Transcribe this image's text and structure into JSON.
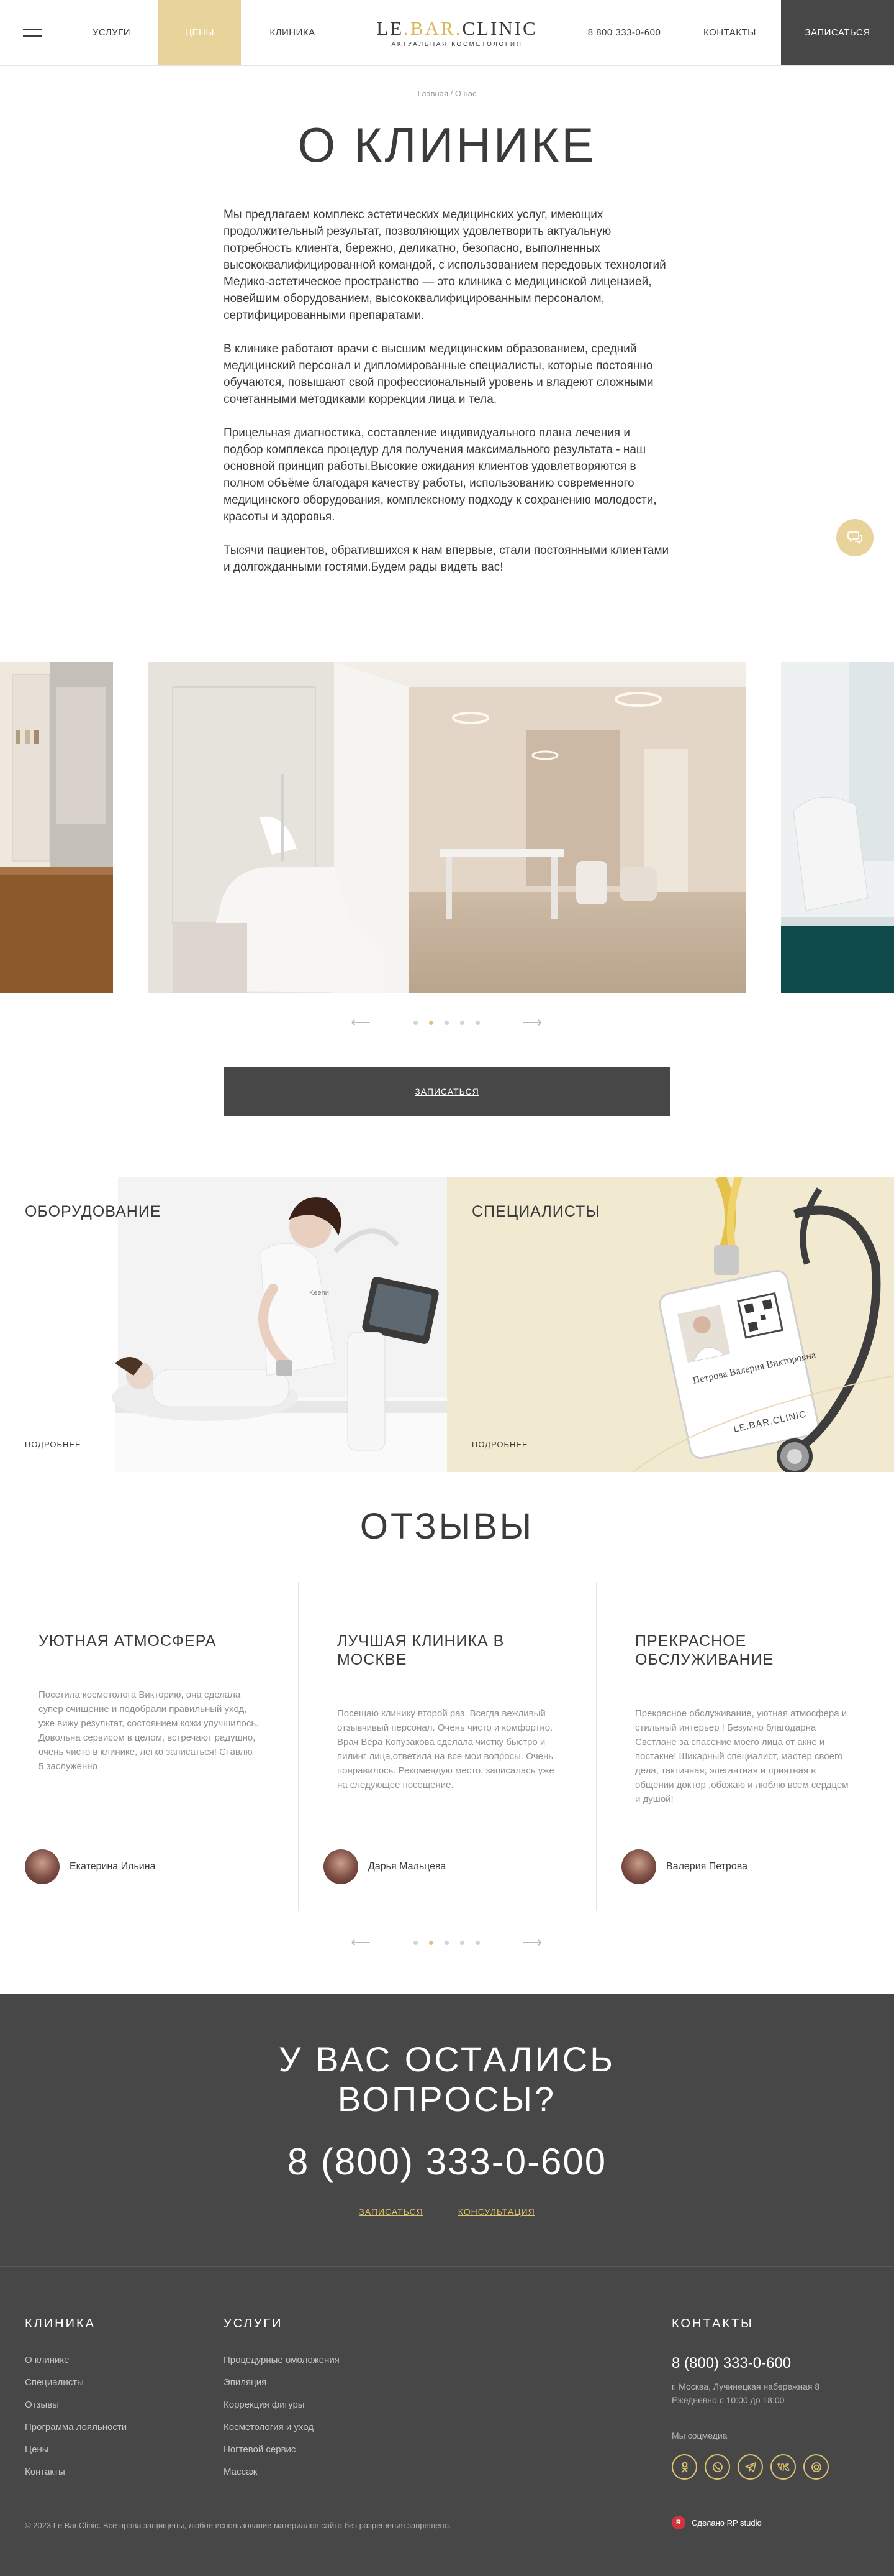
{
  "header": {
    "nav_services": "УСЛУГИ",
    "nav_prices": "ЦЕНЫ",
    "nav_clinic": "КЛИНИКА",
    "logo_main_a": "LE",
    "logo_main_b": ".BAR.",
    "logo_main_c": "CLINIC",
    "logo_sub": "АКТУАЛЬНАЯ КОСМЕТОЛОГИЯ",
    "phone": "8 800 333-0-600",
    "nav_contacts": "КОНТАКТЫ",
    "signup": "ЗАПИСАТЬСЯ"
  },
  "breadcrumb": "Главная / О нас",
  "page_title": "О КЛИНИКЕ",
  "about": {
    "p1": "Мы предлагаем комплекс эстетических медицинских услуг, имеющих продолжительный результат, позволяющих удовлетворить актуальную потребность клиента, бережно, деликатно, безопасно, выполненных высококвалифицированной командой, с использованием передовых технологий Медико-эстетическое пространство — это клиника с медицинской лицензией, новейшим оборудованием, высококвалифицированным персоналом, сертифицированными препаратами.",
    "p2": "В клинике работают врачи с высшим медицинским образованием, средний медицинский персонал и дипломированные специалисты, которые постоянно обучаются, повышают свой профессиональный уровень и владеют сложными сочетанными методиками коррекции лица и тела.",
    "p3": "Прицельная диагностика, составление индивидуального плана лечения и подбор комплекса процедур для получения максимального результата - наш основной принцип работы.Высокие ожидания клиентов удовлетворяются в полном объёме благодаря качеству работы, использованию современного медицинского оборудования, комплексному подходу к сохранению молодости, красоты и здоровья.",
    "p4": "Тысячи пациентов, обратившихся к нам впервые, стали постоянными клиентами и долгожданными гостями.Будем рады видеть вас!"
  },
  "slider": {
    "arrow_prev": "⟵",
    "arrow_next": "⟶",
    "active_dot": 1,
    "dot_count": 5
  },
  "signup_button": "ЗАПИСАТЬСЯ",
  "cards": {
    "equipment_title": "ОБОРУДОВАНИЕ",
    "equipment_more": "ПОДРОБНЕЕ",
    "specialists_title": "СПЕЦИАЛИСТЫ",
    "specialists_more": "ПОДРОБНЕЕ",
    "badge_name": "Петрова Валерия Викторовна",
    "badge_logo": "LE.BAR.CLINIC",
    "apron_text": "Keenи"
  },
  "reviews_title": "ОТЗЫВЫ",
  "reviews": [
    {
      "title": "УЮТНАЯ АТМОСФЕРА",
      "text": "Посетила косметолога Викторию, она сделала супер очищение и подобрали правильный уход, уже вижу результат, состоянием кожи улучшилось. Довольна сервисом в целом, встречают радушно, очень чисто в клинике, легко записаться! Ставлю 5 заслуженно",
      "author": "Екатерина Ильина"
    },
    {
      "title": "ЛУЧШАЯ КЛИНИКА В МОСКВЕ",
      "text": "Посещаю клинику второй раз. Всегда вежливый отзывчивый персонал. Очень чисто и комфортно. Врач Вера Копузакова сделала чистку быстро и пилинг лица,ответила на все мои вопросы. Очень понравилось. Рекомендую место, записалась уже на следующее посещение.",
      "author": "Дарья Мальцева"
    },
    {
      "title": "ПРЕКРАСНОЕ ОБСЛУЖИВАНИЕ",
      "text": "Прекрасное обслуживание, уютная атмосфера и стильный интерьер ! Безумно благодарна Светлане за спасение моего лица от акне и постакне! Шикарный специалист, мастер своего дела, тактичная, элегантная и приятная в общении доктор ,обожаю и люблю всем сердцем и душой!",
      "author": "Валерия Петрова"
    }
  ],
  "questions": {
    "title_line1": "У ВАС ОСТАЛИСЬ",
    "title_line2": "ВОПРОСЫ?",
    "phone": "8 (800) 333-0-600",
    "link_signup": "ЗАПИСАТЬСЯ",
    "link_consult": "КОНСУЛЬТАЦИЯ"
  },
  "footer": {
    "clinic_head": "КЛИНИКА",
    "clinic_items": [
      "О клинике",
      "Специалисты",
      "Отзывы",
      "Программа лояльности",
      "Цены",
      "Контакты"
    ],
    "services_head": "УСЛУГИ",
    "services_items": [
      "Процедурные омоложения",
      "Эпиляция",
      "Коррекция фигуры",
      "Косметология и уход",
      "Ногтевой сервис",
      "Массаж"
    ],
    "contacts_head": "КОНТАКТЫ",
    "phone": "8 (800) 333-0-600",
    "address": "г. Москва, Лучинецкая набережная 8",
    "hours": "Ежедневно с 10:00 до 18:00",
    "social_label": "Мы соцмедиа",
    "copyright": "© 2023 Le.Bar.Clinic. Все права защищены, любое использование материалов сайта без разрешения запрещено.",
    "made_by": "Сделано RP studio",
    "made_logo": "R"
  },
  "colors": {
    "accent_gold": "#e8d39a",
    "dark_gray": "#474747"
  }
}
